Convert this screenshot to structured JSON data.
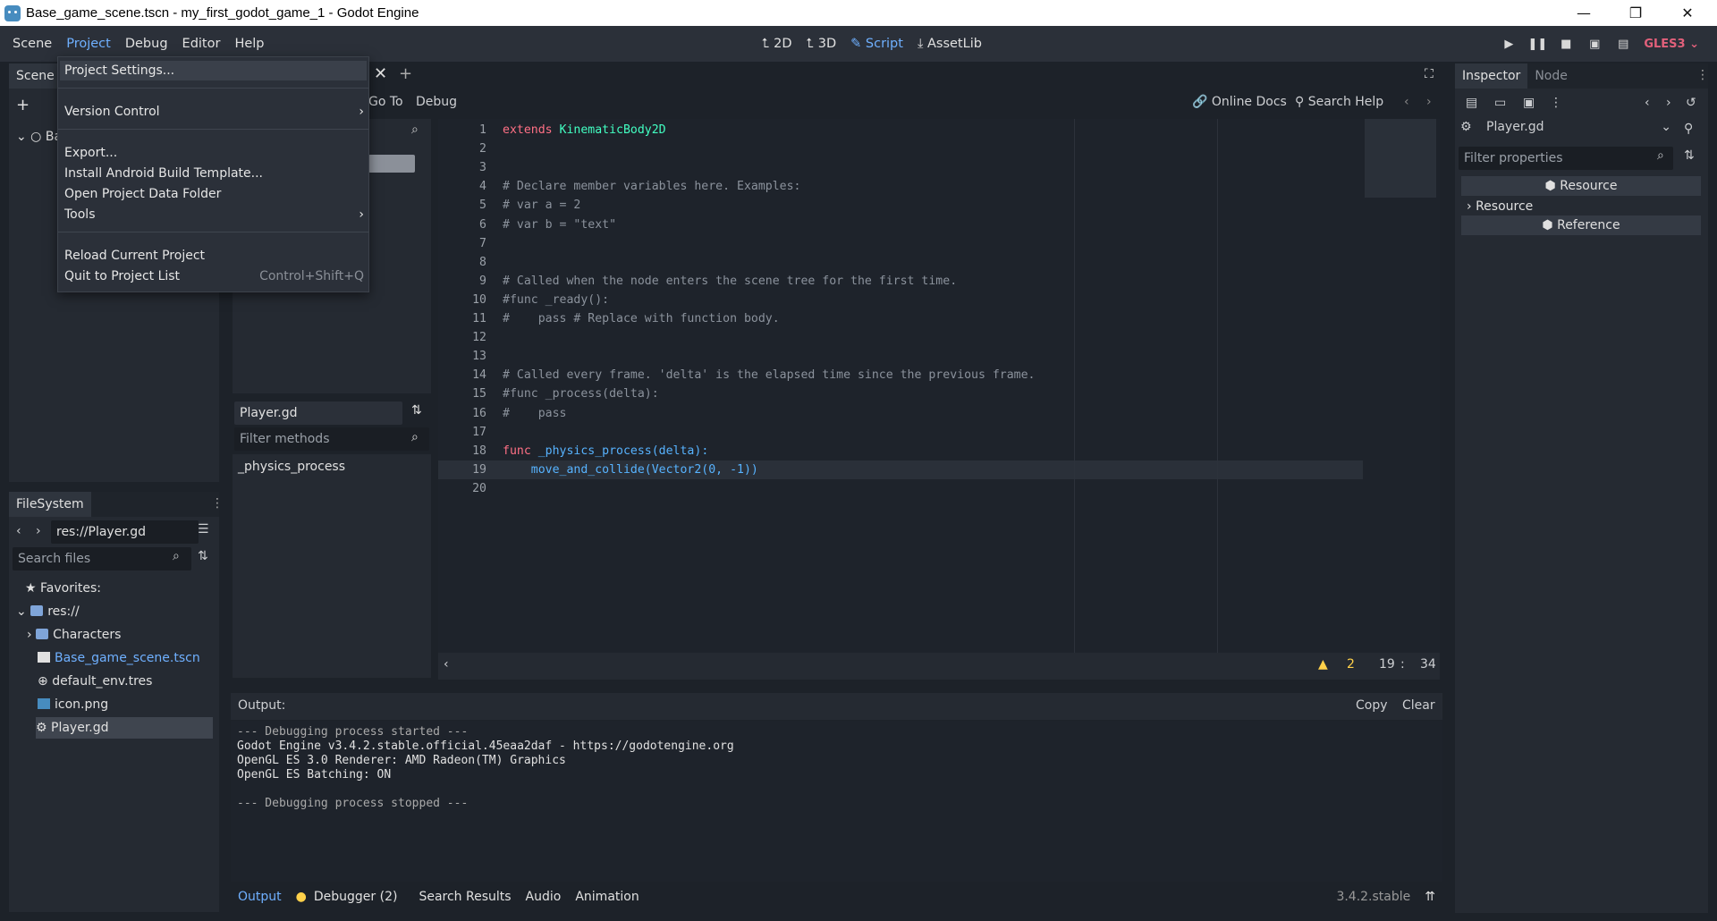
{
  "window": {
    "title": "Base_game_scene.tscn - my_first_godot_game_1 - Godot Engine"
  },
  "menubar": {
    "items": [
      "Scene",
      "Project",
      "Debug",
      "Editor",
      "Help"
    ]
  },
  "workspaces": [
    "2D",
    "3D",
    "Script",
    "AssetLib"
  ],
  "renderer": "GLES3",
  "project_menu": {
    "items": [
      "Project Settings...",
      "Version Control",
      "Export...",
      "Install Android Build Template...",
      "Open Project Data Folder",
      "Tools",
      "Reload Current Project",
      "Quit to Project List"
    ],
    "shortcut_quit": "Control+Shift+Q"
  },
  "scene_panel": {
    "tab": "Scene",
    "root_label": "Ba"
  },
  "script_toolbar": {
    "goto": "Go To",
    "debug": "Debug",
    "online_docs": "Online Docs",
    "search_help": "Search Help"
  },
  "script_list": {
    "current": "Player.gd",
    "filter_placeholder": "Filter methods",
    "methods": [
      "_physics_process"
    ]
  },
  "code_lines": [
    "extends KinematicBody2D",
    "",
    "",
    "# Declare member variables here. Examples:",
    "# var a = 2",
    "# var b = \"text\"",
    "",
    "",
    "# Called when the node enters the scene tree for the first time.",
    "#func _ready():",
    "#\tpass # Replace with function body.",
    "",
    "",
    "# Called every frame. 'delta' is the elapsed time since the previous frame.",
    "#func _process(delta):",
    "#\tpass",
    "",
    "func _physics_process(delta):",
    "\tmove_and_collide(Vector2(0, -1))",
    ""
  ],
  "code_status": {
    "warnings": "2",
    "line": "19",
    "col": "34"
  },
  "filesystem": {
    "tab": "FileSystem",
    "path": "res://Player.gd",
    "search_placeholder": "Search files",
    "favorites": "Favorites:",
    "root": "res://",
    "items": [
      "Characters",
      "Base_game_scene.tscn",
      "default_env.tres",
      "icon.png",
      "Player.gd"
    ]
  },
  "output": {
    "label": "Output:",
    "copy": "Copy",
    "clear": "Clear",
    "lines": [
      "--- Debugging process started ---",
      "Godot Engine v3.4.2.stable.official.45eaa2daf - https://godotengine.org",
      "OpenGL ES 3.0 Renderer: AMD Radeon(TM) Graphics",
      "OpenGL ES Batching: ON",
      "",
      "--- Debugging process stopped ---"
    ]
  },
  "bottom_tabs": [
    "Output",
    "Debugger (2)",
    "Search Results",
    "Audio",
    "Animation"
  ],
  "version": "3.4.2.stable",
  "inspector": {
    "tabs": [
      "Inspector",
      "Node"
    ],
    "resource_name": "Player.gd",
    "filter_placeholder": "Filter properties",
    "sections": [
      "Resource",
      "Resource",
      "Reference"
    ]
  }
}
